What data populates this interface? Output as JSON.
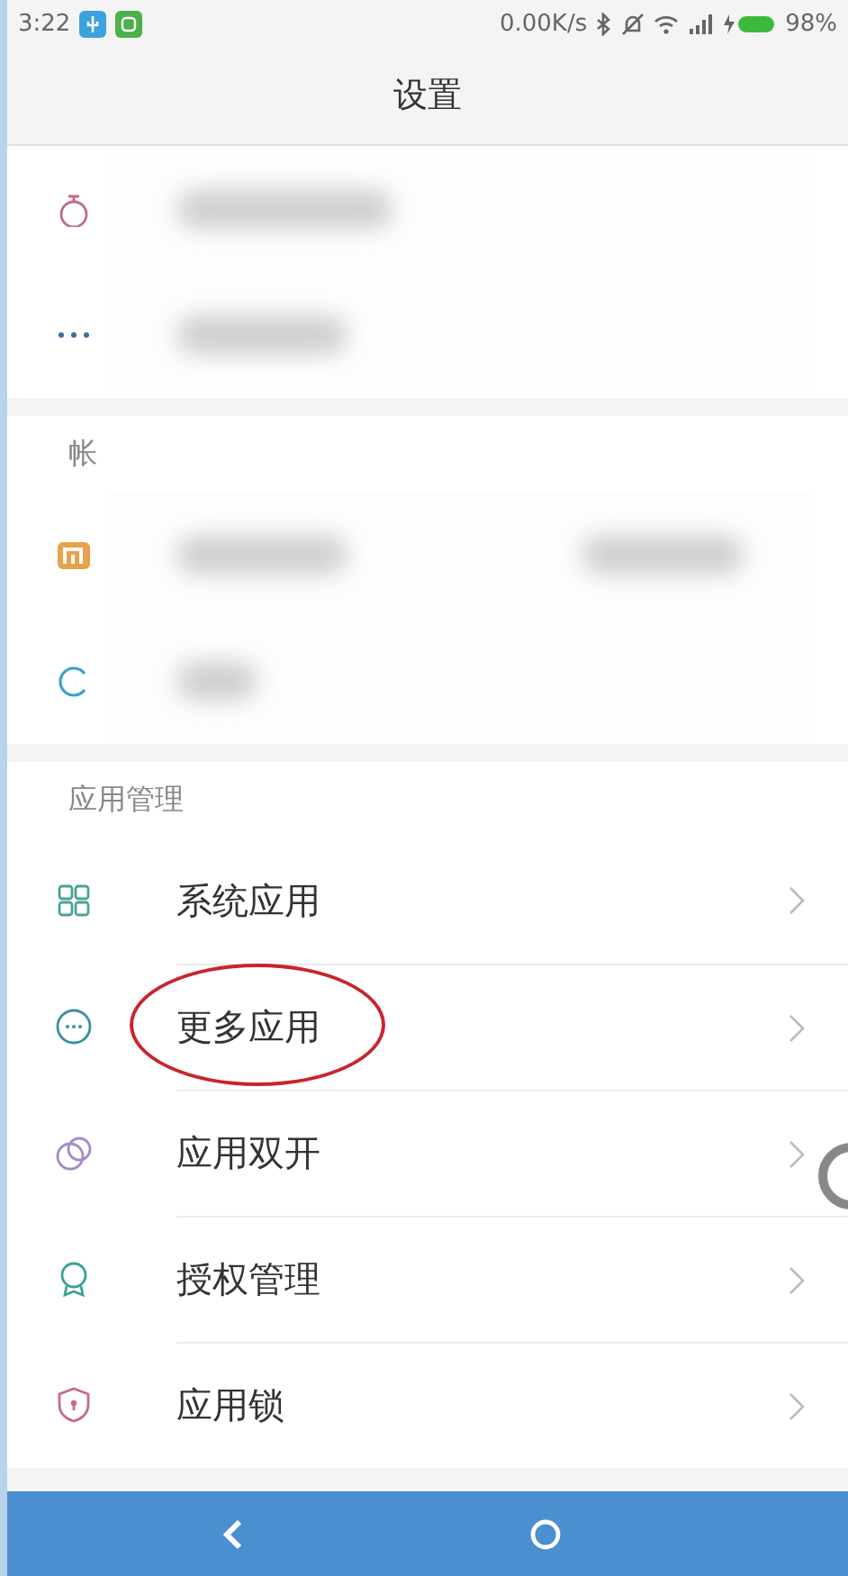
{
  "status_bar": {
    "time": "3:22",
    "speed": "0.00K/s",
    "battery": "98%"
  },
  "title": "设置",
  "sections": [
    {
      "rows": [
        {
          "blurred": true
        },
        {
          "blurred": true
        }
      ]
    },
    {
      "header": "帐",
      "rows": [
        {
          "blurred": true
        },
        {
          "blurred": true
        }
      ]
    },
    {
      "header": "应用管理",
      "rows": [
        {
          "label": "系统应用",
          "circled": false
        },
        {
          "label": "更多应用",
          "circled": true
        },
        {
          "label": "应用双开",
          "circled": false
        },
        {
          "label": "授权管理",
          "circled": false
        },
        {
          "label": "应用锁",
          "circled": false
        }
      ]
    }
  ]
}
